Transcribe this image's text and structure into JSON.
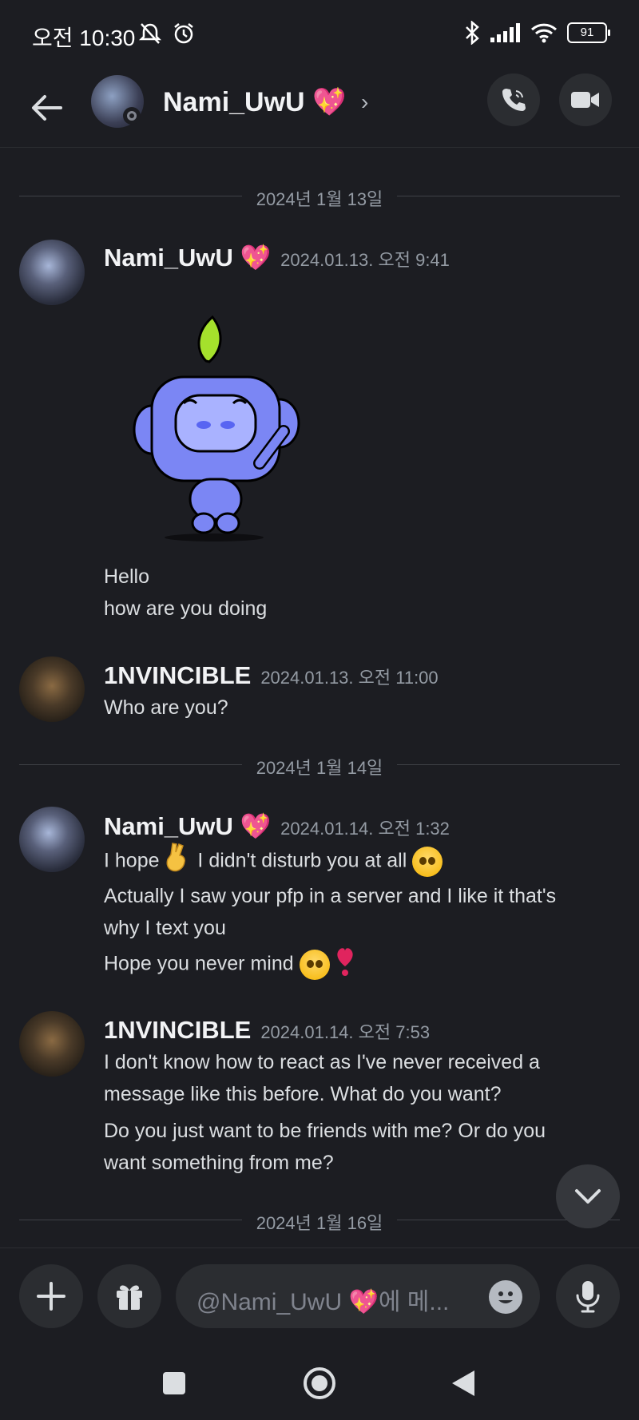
{
  "status_bar": {
    "time": "오전 10:30",
    "battery": "91"
  },
  "header": {
    "name": "Nami_UwU 💖",
    "chevron": "›"
  },
  "dividers": [
    "2024년 1월 13일",
    "2024년 1월 14일",
    "2024년 1월 16일"
  ],
  "messages": [
    {
      "author": "Nami_UwU 💖",
      "timestamp": "2024.01.13. 오전 9:41",
      "lines": [
        "Hello",
        "how are you doing"
      ]
    },
    {
      "author": "1NVINCIBLE",
      "timestamp": "2024.01.13. 오전 11:00",
      "lines": [
        "Who are you?"
      ]
    },
    {
      "author": "Nami_UwU 💖",
      "timestamp": "2024.01.14. 오전 1:32",
      "lines": [
        "I hope",
        "I didn't disturb you at all",
        "Actually I saw your pfp in a server and I like it that's",
        "why I text you",
        "Hope you never mind"
      ]
    },
    {
      "author": "1NVINCIBLE",
      "timestamp": "2024.01.14. 오전 7:53",
      "lines": [
        "I don't know how to react as I've never received a",
        "message like this before. What do you want?",
        "Do you just want to be friends with me? Or do you",
        "want something from me?"
      ]
    }
  ],
  "input": {
    "placeholder": "@Nami_UwU 💖에 메..."
  },
  "colors": {
    "background": "#1c1d22",
    "blurple": "#5865f2",
    "muted": "#949ba4"
  }
}
